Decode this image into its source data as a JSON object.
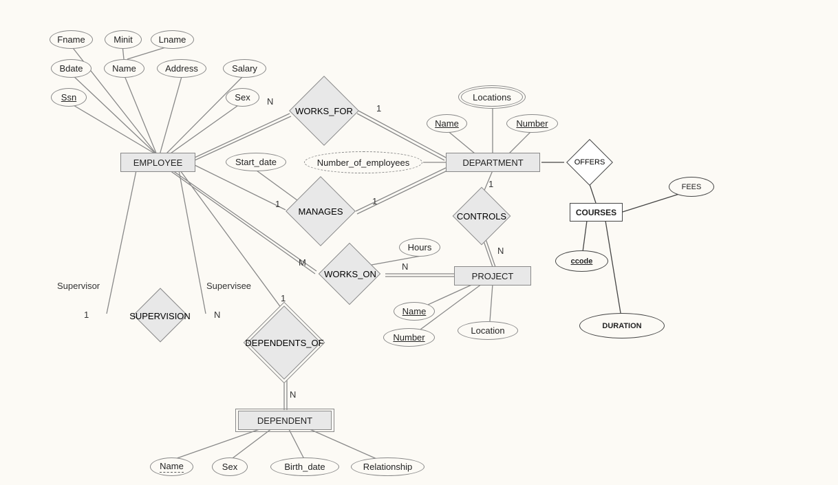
{
  "entities": {
    "employee": "EMPLOYEE",
    "department": "DEPARTMENT",
    "project": "PROJECT",
    "dependent": "DEPENDENT",
    "courses": "COURSES"
  },
  "relationships": {
    "works_for": "WORKS_FOR",
    "manages": "MANAGES",
    "controls": "CONTROLS",
    "works_on": "WORKS_ON",
    "supervision": "SUPERVISION",
    "dependents_of": "DEPENDENTS_OF",
    "offers": "OFFERS"
  },
  "attributes": {
    "fname": "Fname",
    "minit": "Minit",
    "lname": "Lname",
    "bdate": "Bdate",
    "name_emp": "Name",
    "address": "Address",
    "salary": "Salary",
    "ssn": "Ssn",
    "sex_emp": "Sex",
    "start_date": "Start_date",
    "number_of_employees": "Number_of_employees",
    "locations": "Locations",
    "name_dept": "Name",
    "number_dept": "Number",
    "hours": "Hours",
    "name_proj": "Name",
    "number_proj": "Number",
    "location_proj": "Location",
    "name_dep": "Name",
    "sex_dep": "Sex",
    "birth_date": "Birth_date",
    "relationship_dep": "Relationship",
    "fees": "FEES",
    "ccode": "ccode",
    "duration": "DURATION"
  },
  "roles": {
    "supervisor": "Supervisor",
    "supervisee": "Supervisee"
  },
  "cardinalities": {
    "works_for_emp": "N",
    "works_for_dept": "1",
    "manages_emp": "1",
    "manages_dept": "1",
    "controls_dept": "1",
    "controls_proj": "N",
    "works_on_emp": "M",
    "works_on_proj": "N",
    "supervision_supervisor": "1",
    "supervision_supervisee": "N",
    "dependents_of_emp": "1",
    "dependents_of_dep": "N"
  }
}
